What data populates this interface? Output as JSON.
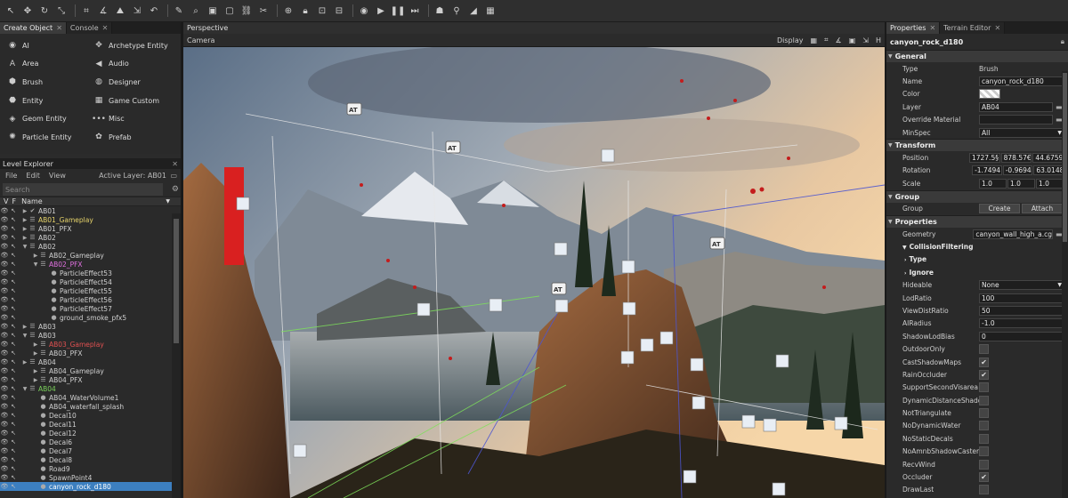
{
  "toolbar": {
    "buttons": [
      "select-icon",
      "move-icon",
      "rotate-icon",
      "scale-icon",
      "snap-icon",
      "snap-angle-icon",
      "terrain-icon",
      "align-icon",
      "undo-icon",
      "paint-icon",
      "search-icon",
      "group-icon",
      "ungroup-icon",
      "link-icon",
      "unlink-icon",
      "attach-icon",
      "lock-icon",
      "lock-sel-icon",
      "unlock-icon",
      "record-icon",
      "play-icon",
      "pause-icon",
      "step-icon",
      "ai-icon",
      "physics-icon",
      "terrain-view-icon",
      "grid-icon"
    ]
  },
  "create_object": {
    "tabs": [
      {
        "label": "Create Object"
      },
      {
        "label": "Console"
      }
    ],
    "items": [
      {
        "label": "AI",
        "icon": "◉"
      },
      {
        "label": "Archetype Entity",
        "icon": "✥"
      },
      {
        "label": "Area",
        "icon": "A"
      },
      {
        "label": "Audio",
        "icon": "◀"
      },
      {
        "label": "Brush",
        "icon": "⬢"
      },
      {
        "label": "Designer",
        "icon": "◍"
      },
      {
        "label": "Entity",
        "icon": "⬣"
      },
      {
        "label": "Game Custom",
        "icon": "▦"
      },
      {
        "label": "Geom Entity",
        "icon": "◈"
      },
      {
        "label": "Misc",
        "icon": "•••"
      },
      {
        "label": "Particle Entity",
        "icon": "✺"
      },
      {
        "label": "Prefab",
        "icon": "✿"
      }
    ]
  },
  "level_explorer": {
    "title": "Level Explorer",
    "menu": [
      "File",
      "Edit",
      "View"
    ],
    "active_layer": "Active Layer: AB01",
    "search_placeholder": "Search",
    "columns": {
      "v": "V",
      "f": "F",
      "name": "Name"
    },
    "rows": [
      {
        "name": "AB01",
        "indent": 0,
        "arrow": "▶",
        "icon": "✔",
        "color": "#d0d0d0"
      },
      {
        "name": "AB01_Gameplay",
        "indent": 0,
        "arrow": "▶",
        "icon": "☰",
        "color": "#e6d36a"
      },
      {
        "name": "AB01_PFX",
        "indent": 0,
        "arrow": "▶",
        "icon": "☰",
        "color": "#d0d0d0"
      },
      {
        "name": "AB02",
        "indent": 0,
        "arrow": "▶",
        "icon": "☰",
        "color": "#d0d0d0"
      },
      {
        "name": "AB02",
        "indent": 0,
        "arrow": "▼",
        "icon": "☰",
        "color": "#d0d0d0"
      },
      {
        "name": "AB02_Gameplay",
        "indent": 1,
        "arrow": "▶",
        "icon": "☰",
        "color": "#d0d0d0"
      },
      {
        "name": "AB02_PFX",
        "indent": 1,
        "arrow": "▼",
        "icon": "☰",
        "color": "#e070e0"
      },
      {
        "name": "ParticleEffect53",
        "indent": 2,
        "arrow": "",
        "icon": "●",
        "color": "#d0d0d0"
      },
      {
        "name": "ParticleEffect54",
        "indent": 2,
        "arrow": "",
        "icon": "●",
        "color": "#d0d0d0"
      },
      {
        "name": "ParticleEffect55",
        "indent": 2,
        "arrow": "",
        "icon": "●",
        "color": "#d0d0d0"
      },
      {
        "name": "ParticleEffect56",
        "indent": 2,
        "arrow": "",
        "icon": "●",
        "color": "#d0d0d0"
      },
      {
        "name": "ParticleEffect57",
        "indent": 2,
        "arrow": "",
        "icon": "●",
        "color": "#d0d0d0"
      },
      {
        "name": "ground_smoke_pfx5",
        "indent": 2,
        "arrow": "",
        "icon": "●",
        "color": "#d0d0d0"
      },
      {
        "name": "AB03",
        "indent": 0,
        "arrow": "▶",
        "icon": "☰",
        "color": "#d0d0d0"
      },
      {
        "name": "AB03",
        "indent": 0,
        "arrow": "▼",
        "icon": "☰",
        "color": "#d0d0d0"
      },
      {
        "name": "AB03_Gameplay",
        "indent": 1,
        "arrow": "▶",
        "icon": "☰",
        "color": "#e05050"
      },
      {
        "name": "AB03_PFX",
        "indent": 1,
        "arrow": "▶",
        "icon": "☰",
        "color": "#d0d0d0"
      },
      {
        "name": "AB04",
        "indent": 0,
        "arrow": "▶",
        "icon": "☰",
        "color": "#d0d0d0"
      },
      {
        "name": "AB04_Gameplay",
        "indent": 1,
        "arrow": "▶",
        "icon": "☰",
        "color": "#d0d0d0"
      },
      {
        "name": "AB04_PFX",
        "indent": 1,
        "arrow": "▶",
        "icon": "☰",
        "color": "#d0d0d0"
      },
      {
        "name": "AB04",
        "indent": 0,
        "arrow": "▼",
        "icon": "☰",
        "color": "#7ad05a"
      },
      {
        "name": "AB04_WaterVolume1",
        "indent": 1,
        "arrow": "",
        "icon": "●",
        "color": "#d0d0d0"
      },
      {
        "name": "AB04_waterfall_splash",
        "indent": 1,
        "arrow": "",
        "icon": "●",
        "color": "#d0d0d0"
      },
      {
        "name": "Decal10",
        "indent": 1,
        "arrow": "",
        "icon": "●",
        "color": "#d0d0d0"
      },
      {
        "name": "Decal11",
        "indent": 1,
        "arrow": "",
        "icon": "●",
        "color": "#d0d0d0"
      },
      {
        "name": "Decal12",
        "indent": 1,
        "arrow": "",
        "icon": "●",
        "color": "#d0d0d0"
      },
      {
        "name": "Decal6",
        "indent": 1,
        "arrow": "",
        "icon": "●",
        "color": "#d0d0d0"
      },
      {
        "name": "Decal7",
        "indent": 1,
        "arrow": "",
        "icon": "●",
        "color": "#d0d0d0"
      },
      {
        "name": "Decal8",
        "indent": 1,
        "arrow": "",
        "icon": "●",
        "color": "#d0d0d0"
      },
      {
        "name": "Road9",
        "indent": 1,
        "arrow": "",
        "icon": "●",
        "color": "#d0d0d0"
      },
      {
        "name": "SpawnPoint4",
        "indent": 1,
        "arrow": "",
        "icon": "●",
        "color": "#d0d0d0"
      },
      {
        "name": "canyon_rock_d180",
        "indent": 1,
        "arrow": "",
        "icon": "●",
        "color": "#ffffff",
        "selected": true
      }
    ]
  },
  "viewport": {
    "tab": "Perspective",
    "camera_label": "Camera",
    "display_label": "Display",
    "help_label": "H"
  },
  "properties": {
    "tabs": [
      {
        "label": "Properties"
      },
      {
        "label": "Terrain Editor"
      }
    ],
    "object_name": "canyon_rock_d180",
    "general": {
      "title": "General",
      "type_label": "Type",
      "type_value": "Brush",
      "name_label": "Name",
      "name_value": "canyon_rock_d180",
      "color_label": "Color",
      "layer_label": "Layer",
      "layer_value": "AB04",
      "override_label": "Override Material",
      "minspec_label": "MinSpec",
      "minspec_value": "All"
    },
    "transform": {
      "title": "Transform",
      "position_label": "Position",
      "position": [
        "1727.5§",
        "878.57€",
        "44.6759"
      ],
      "rotation_label": "Rotation",
      "rotation": [
        "-1.7494",
        "-0.9694",
        "63.0148"
      ],
      "scale_label": "Scale",
      "scale": [
        "1.0",
        "1.0",
        "1.0"
      ]
    },
    "group": {
      "title": "Group",
      "group_label": "Group",
      "create_label": "Create",
      "attach_label": "Attach"
    },
    "props": {
      "title": "Properties",
      "geometry_label": "Geometry",
      "geometry_value": "canyon_wall_high_a.cg",
      "collision_label": "CollisionFiltering",
      "type_label": "Type",
      "ignore_label": "Ignore",
      "hideable_label": "Hideable",
      "hideable_value": "None",
      "lod_label": "LodRatio",
      "lod_value": "100",
      "viewdist_label": "ViewDistRatio",
      "viewdist_value": "50",
      "airadius_label": "AIRadius",
      "airadius_value": "-1.0",
      "shadowlod_label": "ShadowLodBias",
      "shadowlod_value": "0",
      "checks": [
        {
          "label": "OutdoorOnly",
          "checked": false
        },
        {
          "label": "CastShadowMaps",
          "checked": true
        },
        {
          "label": "RainOccluder",
          "checked": true
        },
        {
          "label": "SupportSecondVisarea",
          "checked": false
        },
        {
          "label": "DynamicDistanceShado",
          "checked": false
        },
        {
          "label": "NotTriangulate",
          "checked": false
        },
        {
          "label": "NoDynamicWater",
          "checked": false
        },
        {
          "label": "NoStaticDecals",
          "checked": false
        },
        {
          "label": "NoAmnbShadowCaster",
          "checked": false
        },
        {
          "label": "RecvWind",
          "checked": false
        },
        {
          "label": "Occluder",
          "checked": true
        },
        {
          "label": "DrawLast",
          "checked": false
        }
      ]
    }
  },
  "colors": {
    "selection": "#3c7fc0",
    "panel_bg": "#2a2a2a",
    "toolbar_bg": "#2f2f2f"
  }
}
